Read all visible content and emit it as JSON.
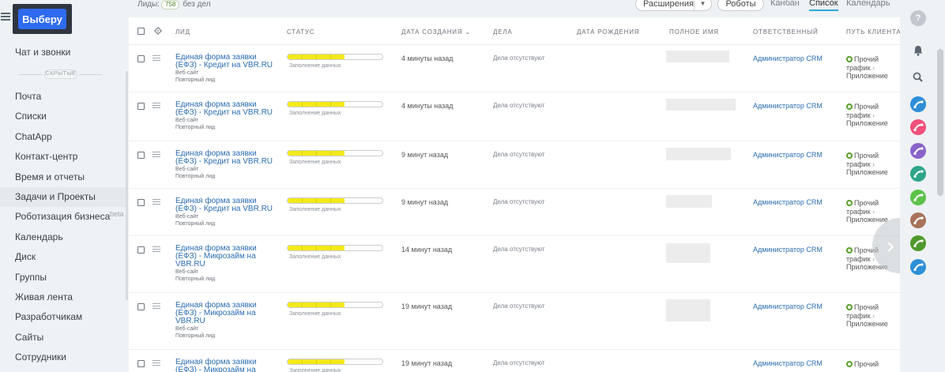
{
  "logo": {
    "label": "Выберу"
  },
  "sidebar": {
    "first_item": "Чат и звонки",
    "hidden_label": "СКРЫТЫЕ",
    "items": [
      {
        "label": "Почта"
      },
      {
        "label": "Списки"
      },
      {
        "label": "ChatApp"
      },
      {
        "label": "Контакт-центр"
      },
      {
        "label": "Время и отчеты"
      },
      {
        "label": "Задачи и Проекты"
      },
      {
        "label": "Роботизация бизнеса",
        "badge": "beta"
      },
      {
        "label": "Календарь"
      },
      {
        "label": "Диск"
      },
      {
        "label": "Группы"
      },
      {
        "label": "Живая лента"
      },
      {
        "label": "Разработчикам"
      },
      {
        "label": "Сайты"
      },
      {
        "label": "Сотрудники"
      }
    ]
  },
  "topbar": {
    "leads_label": "Лиды:",
    "leads_count": "758",
    "no_deals": "без дел",
    "extensions": "Расширения",
    "robots": "Роботы",
    "views": {
      "kanban": "Канбан",
      "list": "Список",
      "calendar": "Календарь"
    }
  },
  "columns": {
    "lead": "ЛИД",
    "status": "СТАТУС",
    "created": "ДАТА СОЗДАНИЯ",
    "deals": "ДЕЛА",
    "birthday": "ДАТА РОЖДЕНИЯ",
    "fullname": "ПОЛНОЕ ИМЯ",
    "responsible": "ОТВЕТСТВЕННЫЙ",
    "path": "ПУТЬ КЛИЕНТА"
  },
  "rows": [
    {
      "title": "Единая форма заявки (ЕФЗ) - Кредит на VBR.RU",
      "source": "Веб-сайт",
      "repeat": "Повторный лид",
      "status": "Заполнение данных",
      "progress": 0.6,
      "created": "4 минуты назад",
      "deals": "Дела отсутствуют",
      "responsible": "Администратор CRM",
      "path": [
        "Прочий",
        "трафик",
        "Приложение"
      ]
    },
    {
      "title": "Единая форма заявки (ЕФЗ) - Кредит на VBR.RU",
      "source": "Веб-сайт",
      "repeat": "Повторный лид",
      "status": "Заполнение данных",
      "progress": 0.6,
      "created": "4 минуты назад",
      "deals": "Дела отсутствуют",
      "responsible": "Администратор CRM",
      "path": [
        "Прочий",
        "трафик",
        "Приложение"
      ]
    },
    {
      "title": "Единая форма заявки (ЕФЗ) - Кредит на VBR.RU",
      "source": "Веб-сайт",
      "repeat": "Повторный лид",
      "status": "Заполнение данных",
      "progress": 0.6,
      "created": "9 минут назад",
      "deals": "Дела отсутствуют",
      "responsible": "Администратор CRM",
      "path": [
        "Прочий",
        "трафик",
        "Приложение"
      ]
    },
    {
      "title": "Единая форма заявки (ЕФЗ) - Кредит на VBR.RU",
      "source": "Веб-сайт",
      "repeat": "Повторный лид",
      "status": "Заполнение данных",
      "progress": 0.6,
      "created": "9 минут назад",
      "deals": "Дела отсутствуют",
      "responsible": "Администратор CRM",
      "path": [
        "Прочий",
        "трафик",
        "Приложение"
      ]
    },
    {
      "title": "Единая форма заявки (ЕФЗ) - Микрозайм на VBR.RU",
      "source": "Веб-сайт",
      "repeat": "Повторный лид",
      "status": "Заполнение данных",
      "progress": 0.6,
      "created": "14 минут назад",
      "deals": "Дела отсутствуют",
      "responsible": "Администратор CRM",
      "path": [
        "Прочий",
        "трафик",
        "Приложение"
      ]
    },
    {
      "title": "Единая форма заявки (ЕФЗ) - Микрозайм на VBR.RU",
      "source": "Веб-сайт",
      "repeat": "Повторный лид",
      "status": "Заполнение данных",
      "progress": 0.6,
      "created": "19 минут назад",
      "deals": "Дела отсутствуют",
      "responsible": "Администратор CRM",
      "path": [
        "Прочий",
        "трафик",
        "Приложение"
      ]
    },
    {
      "title": "Единая форма заявки (ЕФЗ) - Микрозайм на",
      "source": "",
      "repeat": "",
      "status": "Заполнение данных",
      "progress": 0.6,
      "created": "19 минут назад",
      "deals": "Дела отсутствуют",
      "responsible": "Администратор CRM",
      "path": [
        "Прочий"
      ]
    }
  ],
  "colors": {
    "accent_blue": "#2f6bf0",
    "link": "#2b6db3",
    "status_fill": "#f4ea1a",
    "path_dot": "#5aa02a"
  },
  "right_toolbar": [
    {
      "icon": "help-icon",
      "label": "?"
    },
    {
      "icon": "bell-icon"
    },
    {
      "icon": "search-icon"
    },
    {
      "icon": "phone-icon",
      "color": "#2f8fd8"
    },
    {
      "icon": "phone-icon",
      "color": "#f0507a"
    },
    {
      "icon": "phone-icon",
      "color": "#8a63c9"
    },
    {
      "icon": "phone-icon",
      "color": "#2fa58a"
    },
    {
      "icon": "phone-icon",
      "color": "#5cc24a"
    },
    {
      "icon": "phone-icon",
      "color": "#a8735a"
    },
    {
      "icon": "phone-icon",
      "color": "#4f9a2c"
    },
    {
      "icon": "phone-icon",
      "color": "#2f8fd8"
    }
  ]
}
